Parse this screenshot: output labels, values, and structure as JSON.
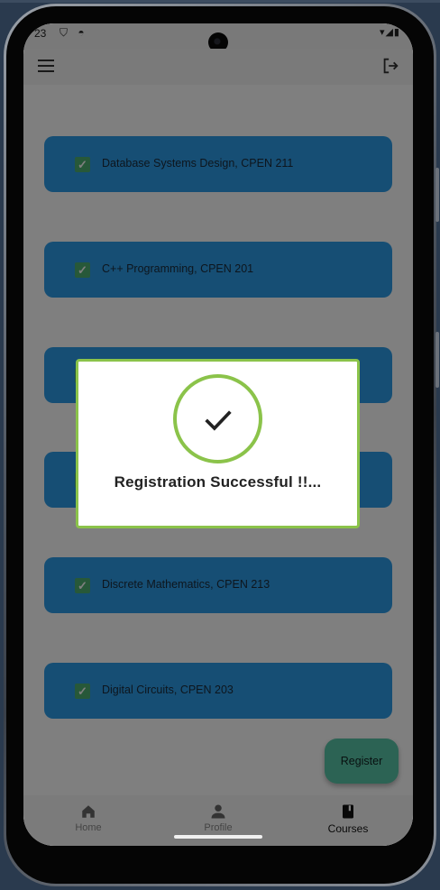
{
  "status_bar": {
    "time": "23",
    "left_icons": "⛉ ◓",
    "right_icons": "▾◢▮"
  },
  "appbar": {
    "menu_icon": "menu-icon",
    "logout_icon": "logout-icon"
  },
  "courses": [
    {
      "label": "Database Systems Design, CPEN 211",
      "checked": true
    },
    {
      "label": "C++ Programming, CPEN 201",
      "checked": true
    },
    {
      "label": "",
      "checked": true
    },
    {
      "label": "",
      "checked": true
    },
    {
      "label": "Discrete Mathematics, CPEN 213",
      "checked": true
    },
    {
      "label": "Digital Circuits, CPEN 203",
      "checked": true
    }
  ],
  "fab": {
    "label": "Register"
  },
  "bottom_nav": [
    {
      "label": "Home",
      "icon": "home-icon",
      "active": false
    },
    {
      "label": "Profile",
      "icon": "person-icon",
      "active": false
    },
    {
      "label": "Courses",
      "icon": "book-icon",
      "active": true
    }
  ],
  "dialog": {
    "title": "Registration Successful !!...",
    "icon": "check-icon"
  },
  "colors": {
    "card": "#2d9de8",
    "checkbox": "#4fb073",
    "fab": "#58c6a8",
    "dialog_border": "#8bc34a"
  }
}
